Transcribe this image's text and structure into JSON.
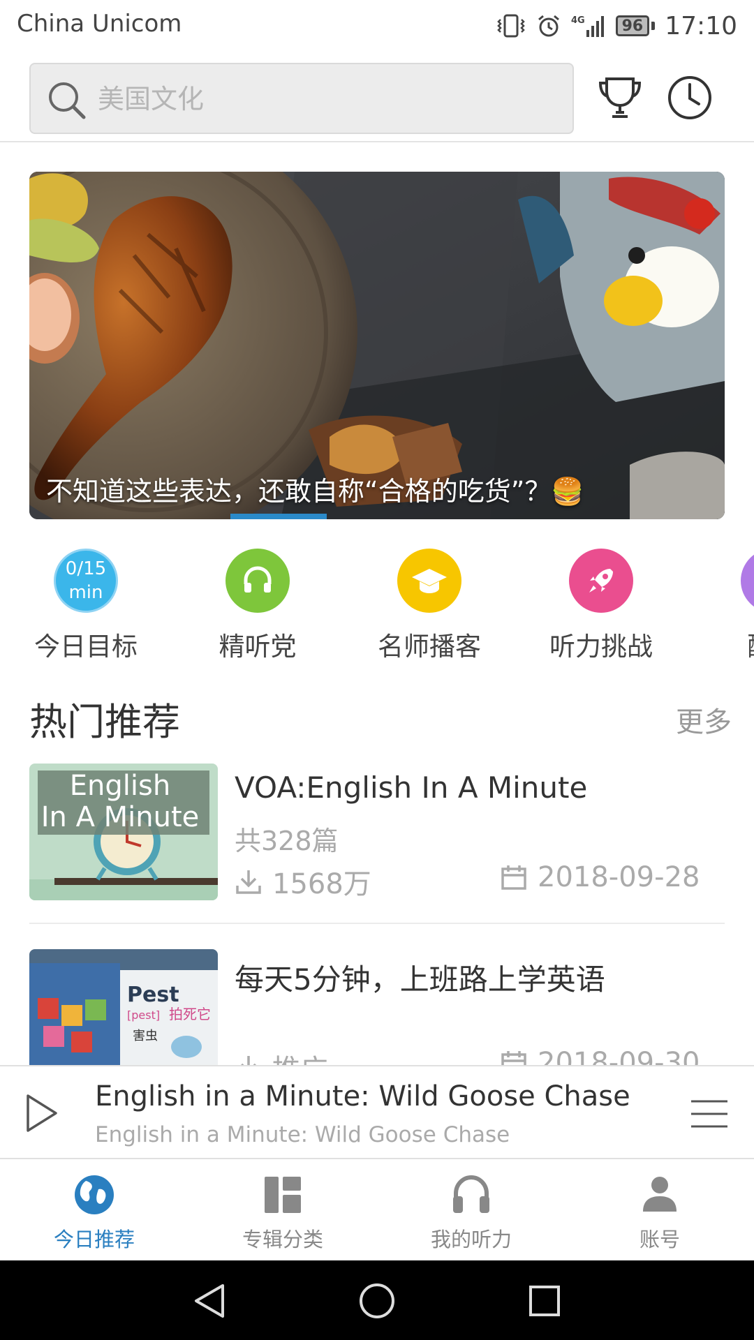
{
  "status_bar": {
    "carrier": "China Unicom",
    "network": "4G",
    "battery": "96",
    "time": "17:10"
  },
  "search": {
    "placeholder": "美国文化"
  },
  "banner": {
    "caption": "不知道这些表达，还敢自称“合格的吃货”？🍔",
    "current_slide_fraction": 0.25
  },
  "quick_entries": [
    {
      "label": "今日目标",
      "goal_line1": "0/15",
      "goal_line2": "min",
      "color": "#3bb6ea",
      "icon": "goal-progress"
    },
    {
      "label": "精听党",
      "color": "#7ec63b",
      "icon": "headphones-icon"
    },
    {
      "label": "名师播客",
      "color": "#f7c600",
      "icon": "graduation-cap-icon"
    },
    {
      "label": "听力挑战",
      "color": "#ea4e8f",
      "icon": "rocket-icon"
    },
    {
      "label": "配音",
      "color": "#b07ae6",
      "icon": "dubbing-icon"
    }
  ],
  "section": {
    "title": "热门推荐",
    "more": "更多"
  },
  "list": [
    {
      "title": "VOA:English In A Minute",
      "count": "共328篇",
      "downloads": "1568万",
      "date": "2018-09-28",
      "thumb_line1": "English",
      "thumb_line2": "In A Minute"
    },
    {
      "title": "每天5分钟，上班路上学英语",
      "count": "",
      "downloads": "推广",
      "date": "2018-09-30",
      "thumb_word": "Pest",
      "thumb_phonetic": "[pest]",
      "thumb_cn1": "拍死它",
      "thumb_cn2": "害虫"
    }
  ],
  "player": {
    "title": "English in a Minute: Wild Goose Chase",
    "subtitle": "English in a Minute: Wild Goose Chase"
  },
  "bottom_nav": [
    {
      "label": "今日推荐",
      "icon": "globe-icon",
      "active": true
    },
    {
      "label": "专辑分类",
      "icon": "category-icon",
      "active": false
    },
    {
      "label": "我的听力",
      "icon": "headphones-icon",
      "active": false
    },
    {
      "label": "账号",
      "icon": "user-icon",
      "active": false
    }
  ],
  "colors": {
    "accent": "#2a7fc0",
    "banner_indicator": "#2a8ac9"
  }
}
